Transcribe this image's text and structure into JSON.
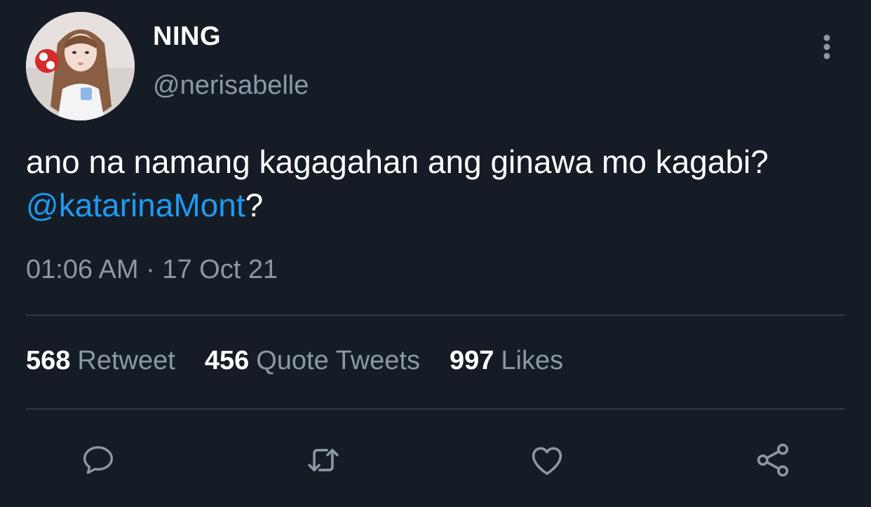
{
  "tweet": {
    "display_name": "NING",
    "handle": "@nerisabelle",
    "text_before": "ano na namang kagagahan ang ginawa mo kagabi? ",
    "mention": "@katarinaMont",
    "text_after": "?",
    "timestamp": "01:06 AM · 17 Oct 21"
  },
  "stats": {
    "retweets": {
      "count": "568",
      "label": "Retweet"
    },
    "quotes": {
      "count": "456",
      "label": "Quote Tweets"
    },
    "likes": {
      "count": "997",
      "label": "Likes"
    }
  },
  "actions": {
    "reply": "reply-icon",
    "retweet": "retweet-icon",
    "like": "heart-icon",
    "share": "share-icon",
    "more": "more-vertical-icon"
  },
  "colors": {
    "background": "#161c26",
    "text": "#ffffff",
    "secondary_text": "#8b98a5",
    "mention": "#1d9bf0",
    "divider": "#2f3943"
  }
}
